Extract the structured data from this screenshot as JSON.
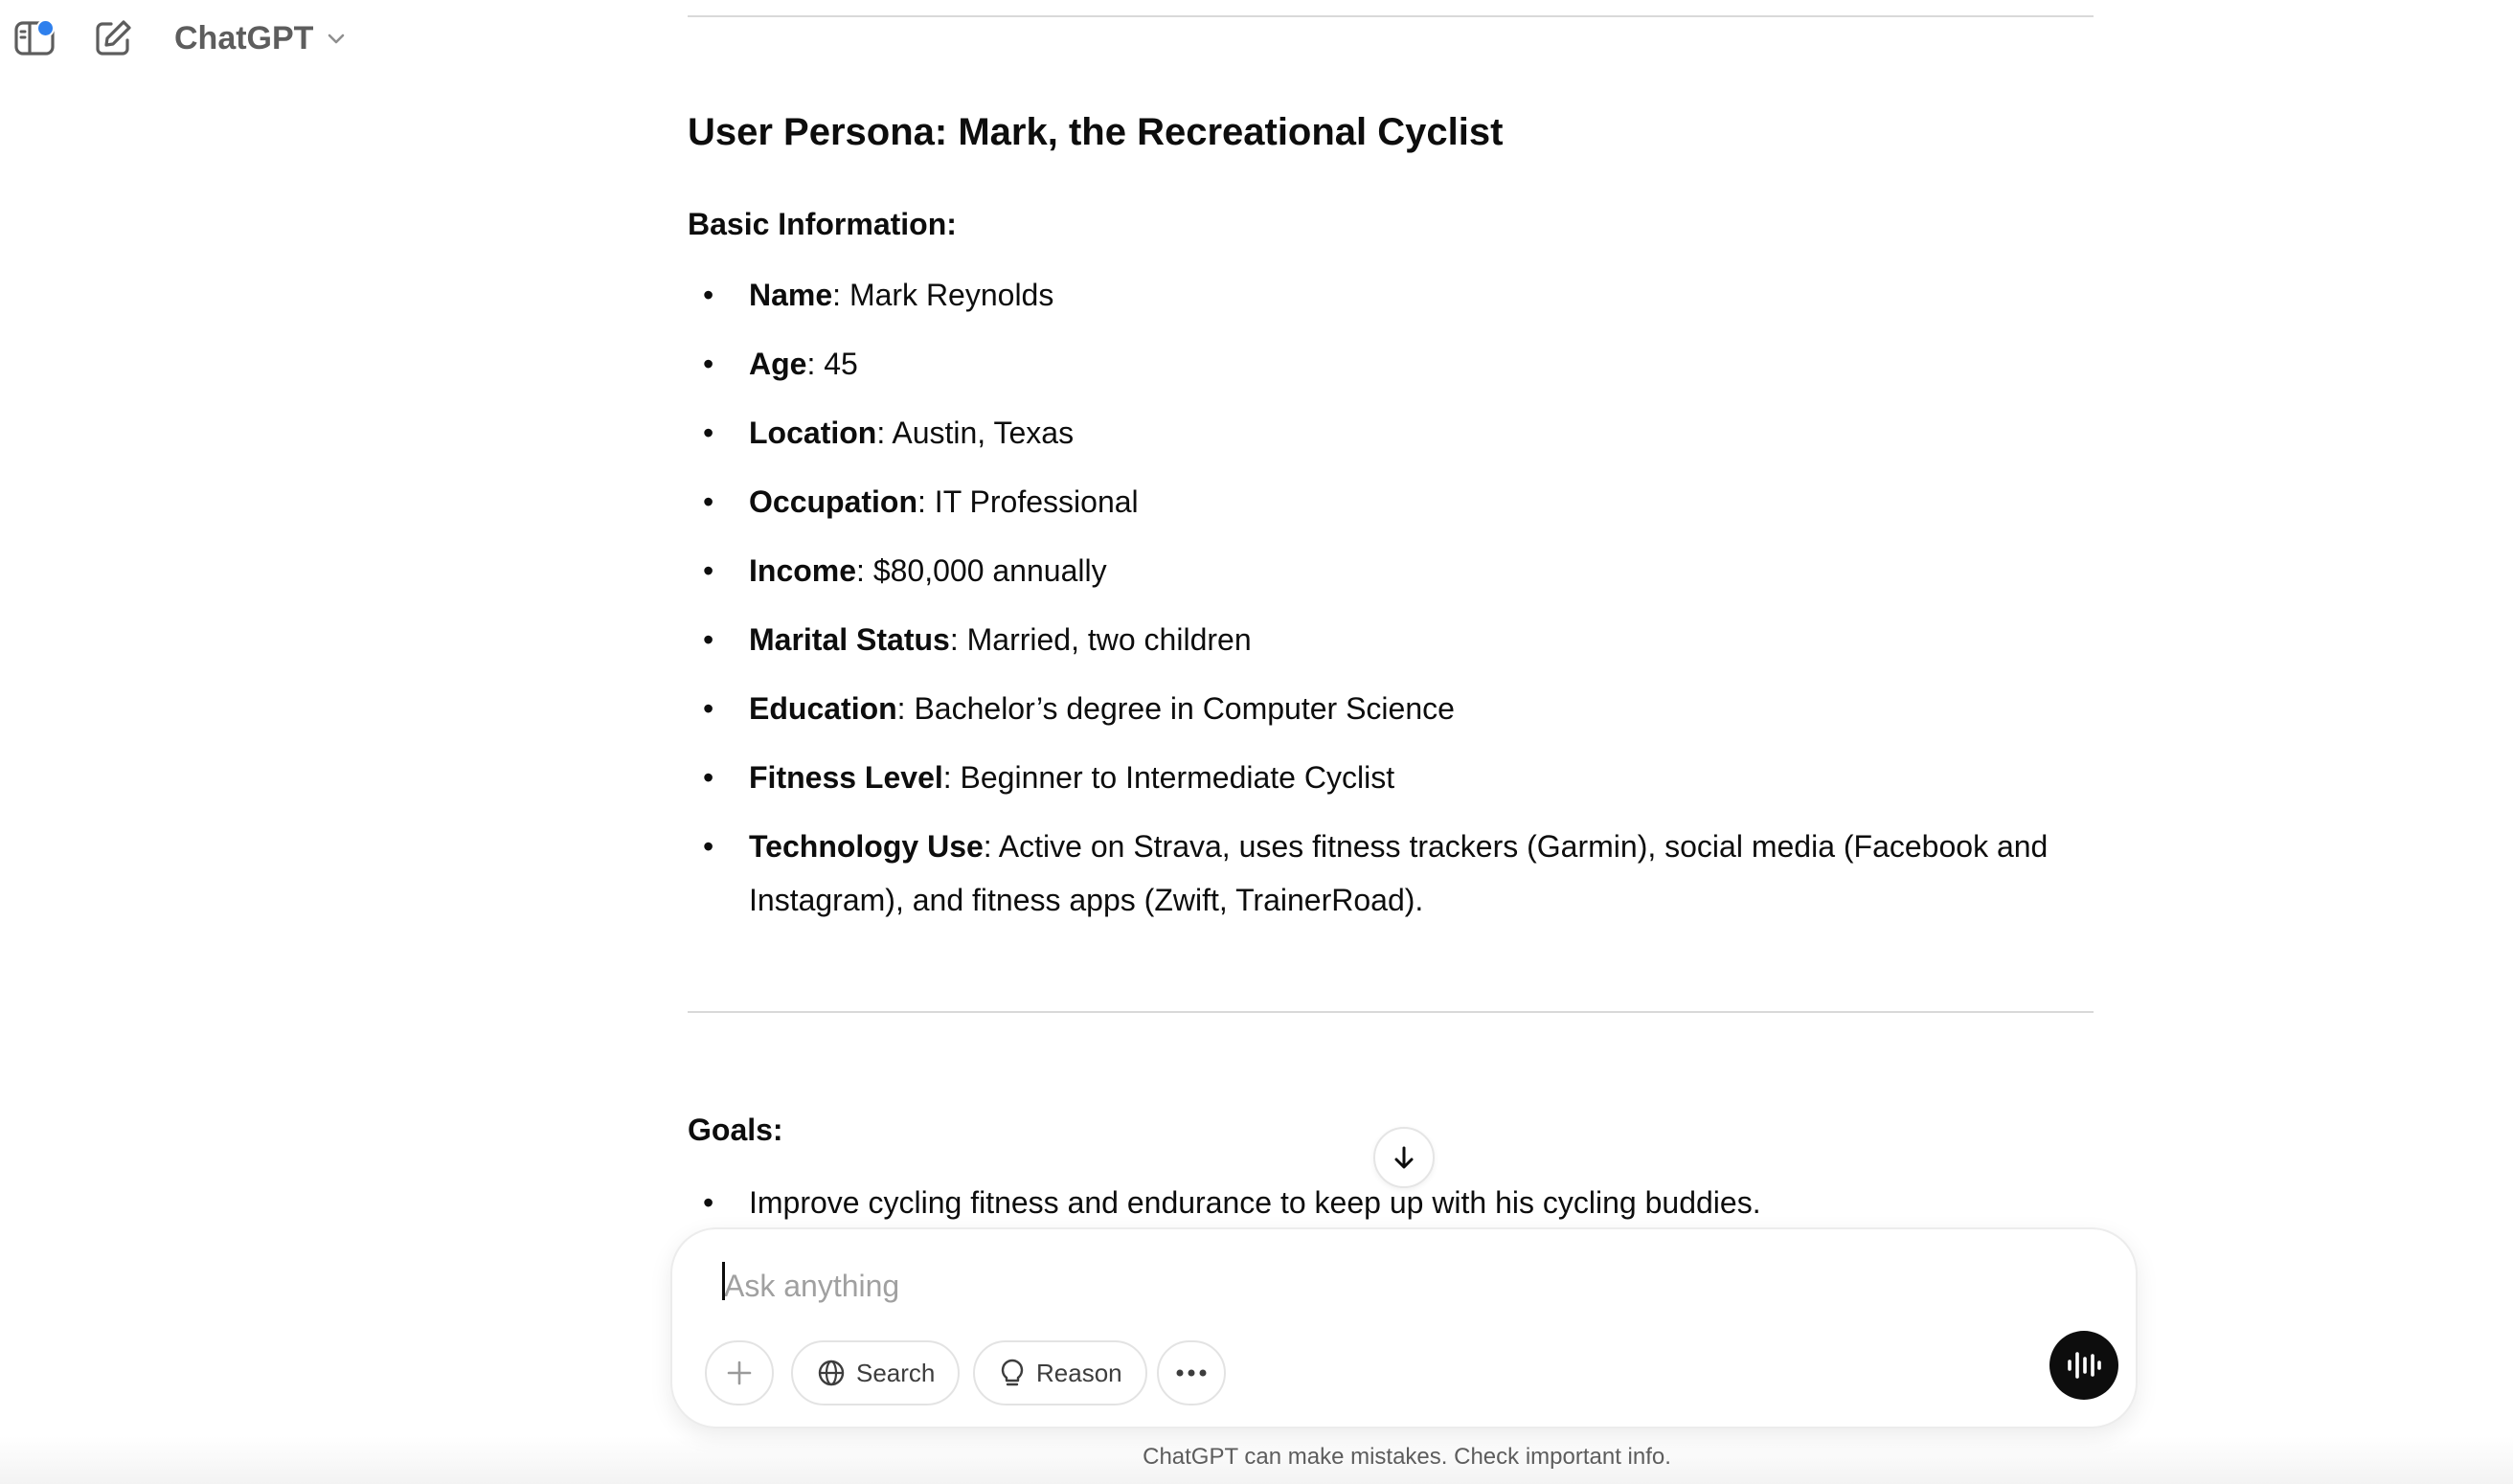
{
  "header": {
    "model_name": "ChatGPT"
  },
  "persona_title": "User Persona: Mark, the Recreational Cyclist",
  "basic_info": {
    "heading": "Basic Information:",
    "items": [
      {
        "label": "Name",
        "value": ": Mark Reynolds"
      },
      {
        "label": "Age",
        "value": ": 45"
      },
      {
        "label": "Location",
        "value": ": Austin, Texas"
      },
      {
        "label": "Occupation",
        "value": ": IT Professional"
      },
      {
        "label": "Income",
        "value": ": $80,000 annually"
      },
      {
        "label": "Marital Status",
        "value": ": Married, two children"
      },
      {
        "label": "Education",
        "value": ": Bachelor’s degree in Computer Science"
      },
      {
        "label": "Fitness Level",
        "value": ": Beginner to Intermediate Cyclist"
      },
      {
        "label": "Technology Use",
        "value": ": Active on Strava, uses fitness trackers (Garmin), social media (Facebook and Instagram), and fitness apps (Zwift, TrainerRoad)."
      }
    ]
  },
  "goals": {
    "heading": "Goals:",
    "items": [
      "Improve cycling fitness and endurance to keep up with his cycling buddies."
    ]
  },
  "composer": {
    "placeholder": "Ask anything",
    "search_label": "Search",
    "reason_label": "Reason"
  },
  "disclaimer": "ChatGPT can make mistakes. Check important info.",
  "icons": {
    "sidebar": "sidebar-toggle-icon",
    "new_chat": "new-chat-icon",
    "scroll": "arrow-down-icon",
    "voice": "voice-mode-icon"
  }
}
